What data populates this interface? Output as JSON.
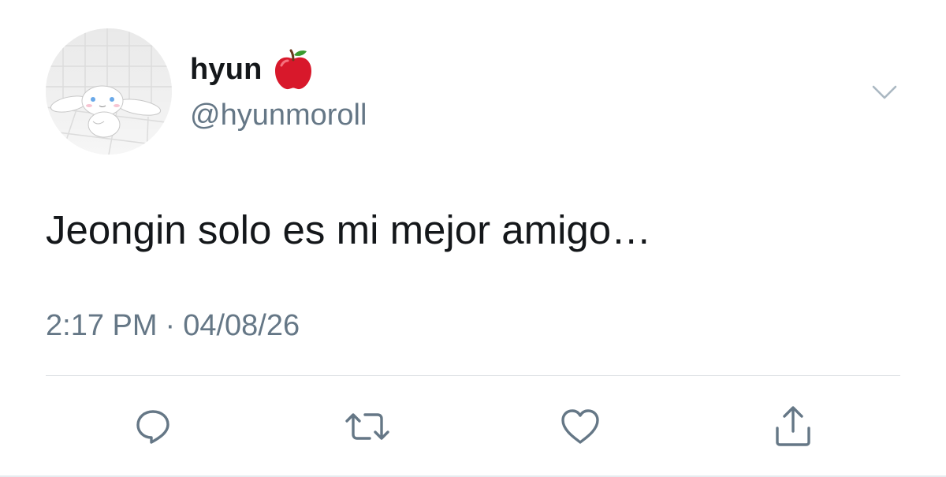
{
  "user": {
    "display_name": "hyun",
    "name_emoji": "red-apple",
    "handle": "@hyunmoroll",
    "avatar": "cinnamoroll-avatar"
  },
  "tweet": {
    "text": "Jeongin solo es mi mejor amigo…",
    "time": "2:17 PM",
    "separator": "·",
    "date": "04/08/26"
  },
  "actions": [
    "reply-icon",
    "retweet-icon",
    "like-icon",
    "share-icon"
  ],
  "colors": {
    "text_primary": "#14171a",
    "text_secondary": "#657786",
    "icon": "#657786",
    "divider": "#d9dde1",
    "apple_red": "#d8182b"
  }
}
